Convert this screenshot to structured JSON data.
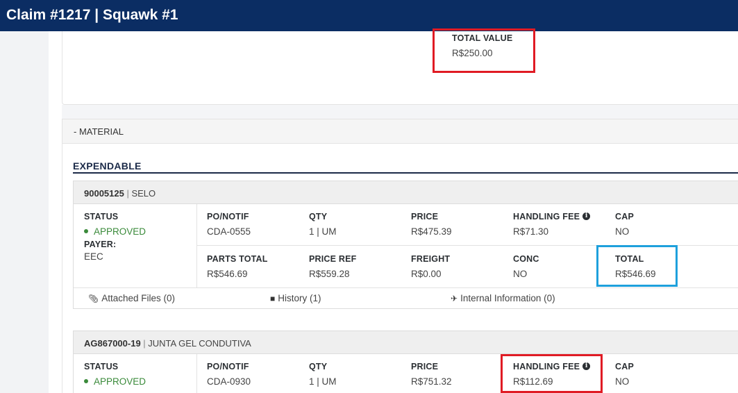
{
  "header": {
    "title": "Claim #1217 | Squawk #1"
  },
  "top_card": {
    "total_value_label": "TOTAL VALUE",
    "total_value": "R$250.00"
  },
  "material": {
    "label": "- MATERIAL",
    "section_title": "EXPENDABLE"
  },
  "items": [
    {
      "code": "90005125",
      "description": "SELO",
      "status_label": "STATUS",
      "status": "APPROVED",
      "payer_label": "PAYER:",
      "payer": "EEC",
      "fields": {
        "po_notif_label": "PO/NOTIF",
        "po_notif": "CDA-0555",
        "qty_label": "QTY",
        "qty": "1 | UM",
        "price_label": "PRICE",
        "price": "R$475.39",
        "handling_fee_label": "HANDLING FEE",
        "handling_fee": "R$71.30",
        "cap_label": "CAP",
        "cap": "NO",
        "parts_total_label": "PARTS TOTAL",
        "parts_total": "R$546.69",
        "price_ref_label": "PRICE REF",
        "price_ref": "R$559.28",
        "freight_label": "FREIGHT",
        "freight": "R$0.00",
        "conc_label": "CONC",
        "conc": "NO",
        "total_label": "TOTAL",
        "total": "R$546.69"
      },
      "links": {
        "attached_files": "Attached Files (0)",
        "history": "History (1)",
        "internal_information": "Internal Information (0)"
      }
    },
    {
      "code": "AG867000-19",
      "description": "JUNTA GEL CONDUTIVA",
      "status_label": "STATUS",
      "status": "APPROVED",
      "fields": {
        "po_notif_label": "PO/NOTIF",
        "po_notif": "CDA-0930",
        "qty_label": "QTY",
        "qty": "1 | UM",
        "price_label": "PRICE",
        "price": "R$751.32",
        "handling_fee_label": "HANDLING FEE",
        "handling_fee": "R$112.69",
        "cap_label": "CAP",
        "cap": "NO"
      }
    }
  ],
  "colors": {
    "header_bg": "#0b2d63",
    "approved": "#3a8a3a",
    "highlight_red": "#e01b24",
    "highlight_blue": "#1ea0dc"
  }
}
